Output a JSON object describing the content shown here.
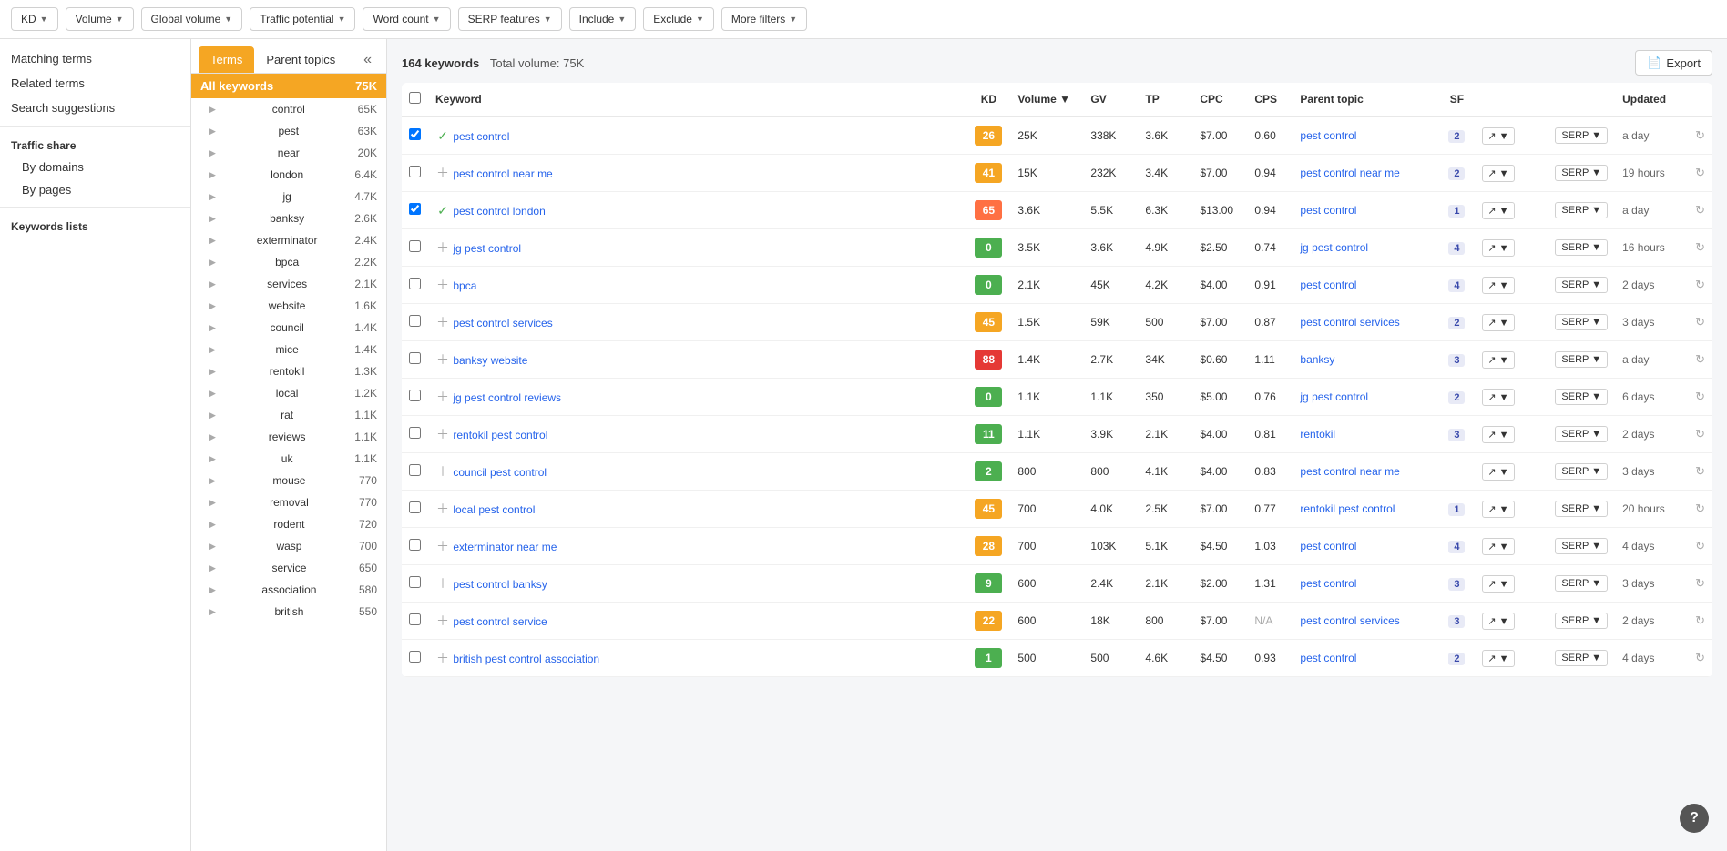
{
  "filterBar": {
    "filters": [
      {
        "label": "KD",
        "id": "kd"
      },
      {
        "label": "Volume",
        "id": "volume"
      },
      {
        "label": "Global volume",
        "id": "global-volume"
      },
      {
        "label": "Traffic potential",
        "id": "traffic-potential"
      },
      {
        "label": "Word count",
        "id": "word-count"
      },
      {
        "label": "SERP features",
        "id": "serp-features"
      },
      {
        "label": "Include",
        "id": "include"
      },
      {
        "label": "Exclude",
        "id": "exclude"
      },
      {
        "label": "More filters",
        "id": "more-filters"
      }
    ]
  },
  "sidebar": {
    "items": [
      {
        "label": "Matching terms",
        "id": "matching-terms"
      },
      {
        "label": "Related terms",
        "id": "related-terms",
        "active": true
      },
      {
        "label": "Search suggestions",
        "id": "search-suggestions"
      }
    ],
    "trafficShare": {
      "title": "Traffic share",
      "items": [
        {
          "label": "By domains",
          "id": "by-domains"
        },
        {
          "label": "By pages",
          "id": "by-pages"
        }
      ]
    },
    "keywordsLists": {
      "title": "Keywords lists"
    }
  },
  "leftPanel": {
    "tabs": [
      {
        "label": "Terms",
        "active": true
      },
      {
        "label": "Parent topics"
      }
    ],
    "allKeywords": {
      "label": "All keywords",
      "count": "75K"
    },
    "keywords": [
      {
        "name": "control",
        "count": "65K"
      },
      {
        "name": "pest",
        "count": "63K"
      },
      {
        "name": "near",
        "count": "20K"
      },
      {
        "name": "london",
        "count": "6.4K"
      },
      {
        "name": "jg",
        "count": "4.7K"
      },
      {
        "name": "banksy",
        "count": "2.6K"
      },
      {
        "name": "exterminator",
        "count": "2.4K"
      },
      {
        "name": "bpca",
        "count": "2.2K"
      },
      {
        "name": "services",
        "count": "2.1K"
      },
      {
        "name": "website",
        "count": "1.6K"
      },
      {
        "name": "council",
        "count": "1.4K"
      },
      {
        "name": "mice",
        "count": "1.4K"
      },
      {
        "name": "rentokil",
        "count": "1.3K"
      },
      {
        "name": "local",
        "count": "1.2K"
      },
      {
        "name": "rat",
        "count": "1.1K"
      },
      {
        "name": "reviews",
        "count": "1.1K"
      },
      {
        "name": "uk",
        "count": "1.1K"
      },
      {
        "name": "mouse",
        "count": "770"
      },
      {
        "name": "removal",
        "count": "770"
      },
      {
        "name": "rodent",
        "count": "720"
      },
      {
        "name": "wasp",
        "count": "700"
      },
      {
        "name": "service",
        "count": "650"
      },
      {
        "name": "association",
        "count": "580"
      },
      {
        "name": "british",
        "count": "550"
      }
    ]
  },
  "results": {
    "count": "164 keywords",
    "totalVolume": "Total volume: 75K",
    "exportLabel": "Export",
    "columns": {
      "keyword": "Keyword",
      "kd": "KD",
      "volume": "Volume",
      "gv": "GV",
      "tp": "TP",
      "cpc": "CPC",
      "cps": "CPS",
      "parentTopic": "Parent topic",
      "sf": "SF",
      "updated": "Updated"
    },
    "rows": [
      {
        "id": 1,
        "checked": true,
        "actionIcon": "check",
        "keyword": "pest control",
        "kd": 26,
        "kdColor": "kd-yellow",
        "volume": "25K",
        "gv": "338K",
        "tp": "3.6K",
        "cpc": "$7.00",
        "cps": "0.60",
        "parentTopic": "pest control",
        "sf": 2,
        "updated": "a day"
      },
      {
        "id": 2,
        "checked": false,
        "actionIcon": "plus",
        "keyword": "pest control near me",
        "kd": 41,
        "kdColor": "kd-yellow",
        "volume": "15K",
        "gv": "232K",
        "tp": "3.4K",
        "cpc": "$7.00",
        "cps": "0.94",
        "parentTopic": "pest control near me",
        "sf": 2,
        "updated": "19 hours"
      },
      {
        "id": 3,
        "checked": true,
        "actionIcon": "check",
        "keyword": "pest control london",
        "kd": 65,
        "kdColor": "kd-orange",
        "volume": "3.6K",
        "gv": "5.5K",
        "tp": "6.3K",
        "cpc": "$13.00",
        "cps": "0.94",
        "parentTopic": "pest control",
        "sf": 1,
        "updated": "a day"
      },
      {
        "id": 4,
        "checked": false,
        "actionIcon": "plus",
        "keyword": "jg pest control",
        "kd": 0,
        "kdColor": "kd-green",
        "volume": "3.5K",
        "gv": "3.6K",
        "tp": "4.9K",
        "cpc": "$2.50",
        "cps": "0.74",
        "parentTopic": "jg pest control",
        "sf": 4,
        "updated": "16 hours"
      },
      {
        "id": 5,
        "checked": false,
        "actionIcon": "plus",
        "keyword": "bpca",
        "kd": 0,
        "kdColor": "kd-green",
        "volume": "2.1K",
        "gv": "45K",
        "tp": "4.2K",
        "cpc": "$4.00",
        "cps": "0.91",
        "parentTopic": "pest control",
        "sf": 4,
        "updated": "2 days"
      },
      {
        "id": 6,
        "checked": false,
        "actionIcon": "plus",
        "keyword": "pest control services",
        "kd": 45,
        "kdColor": "kd-yellow",
        "volume": "1.5K",
        "gv": "59K",
        "tp": "500",
        "cpc": "$7.00",
        "cps": "0.87",
        "parentTopic": "pest control services",
        "sf": 2,
        "updated": "3 days"
      },
      {
        "id": 7,
        "checked": false,
        "actionIcon": "plus",
        "keyword": "banksy website",
        "kd": 88,
        "kdColor": "kd-red",
        "volume": "1.4K",
        "gv": "2.7K",
        "tp": "34K",
        "cpc": "$0.60",
        "cps": "1.11",
        "parentTopic": "banksy",
        "sf": 3,
        "updated": "a day"
      },
      {
        "id": 8,
        "checked": false,
        "actionIcon": "plus",
        "keyword": "jg pest control reviews",
        "kd": 0,
        "kdColor": "kd-green",
        "volume": "1.1K",
        "gv": "1.1K",
        "tp": "350",
        "cpc": "$5.00",
        "cps": "0.76",
        "parentTopic": "jg pest control",
        "sf": 2,
        "updated": "6 days"
      },
      {
        "id": 9,
        "checked": false,
        "actionIcon": "plus",
        "keyword": "rentokil pest control",
        "kd": 11,
        "kdColor": "kd-green",
        "volume": "1.1K",
        "gv": "3.9K",
        "tp": "2.1K",
        "cpc": "$4.00",
        "cps": "0.81",
        "parentTopic": "rentokil",
        "sf": 3,
        "updated": "2 days"
      },
      {
        "id": 10,
        "checked": false,
        "actionIcon": "plus",
        "keyword": "council pest control",
        "kd": 2,
        "kdColor": "kd-green",
        "volume": "800",
        "gv": "800",
        "tp": "4.1K",
        "cpc": "$4.00",
        "cps": "0.83",
        "parentTopic": "pest control near me",
        "sf": "",
        "updated": "3 days"
      },
      {
        "id": 11,
        "checked": false,
        "actionIcon": "plus",
        "keyword": "local pest control",
        "kd": 45,
        "kdColor": "kd-yellow",
        "volume": "700",
        "gv": "4.0K",
        "tp": "2.5K",
        "cpc": "$7.00",
        "cps": "0.77",
        "parentTopic": "rentokil pest control",
        "sf": 1,
        "updated": "20 hours"
      },
      {
        "id": 12,
        "checked": false,
        "actionIcon": "plus",
        "keyword": "exterminator near me",
        "kd": 28,
        "kdColor": "kd-yellow",
        "volume": "700",
        "gv": "103K",
        "tp": "5.1K",
        "cpc": "$4.50",
        "cps": "1.03",
        "parentTopic": "pest control",
        "sf": 4,
        "updated": "4 days"
      },
      {
        "id": 13,
        "checked": false,
        "actionIcon": "plus",
        "keyword": "pest control banksy",
        "kd": 9,
        "kdColor": "kd-green",
        "volume": "600",
        "gv": "2.4K",
        "tp": "2.1K",
        "cpc": "$2.00",
        "cps": "1.31",
        "parentTopic": "pest control",
        "sf": 3,
        "updated": "3 days"
      },
      {
        "id": 14,
        "checked": false,
        "actionIcon": "plus",
        "keyword": "pest control service",
        "kd": 22,
        "kdColor": "kd-yellow",
        "volume": "600",
        "gv": "18K",
        "tp": "800",
        "cpc": "$7.00",
        "cps": "N/A",
        "parentTopic": "pest control services",
        "sf": 3,
        "updated": "2 days"
      },
      {
        "id": 15,
        "checked": false,
        "actionIcon": "plus",
        "keyword": "british pest control association",
        "kd": 1,
        "kdColor": "kd-green",
        "volume": "500",
        "gv": "500",
        "tp": "4.6K",
        "cpc": "$4.50",
        "cps": "0.93",
        "parentTopic": "pest control",
        "sf": 2,
        "updated": "4 days"
      }
    ]
  }
}
